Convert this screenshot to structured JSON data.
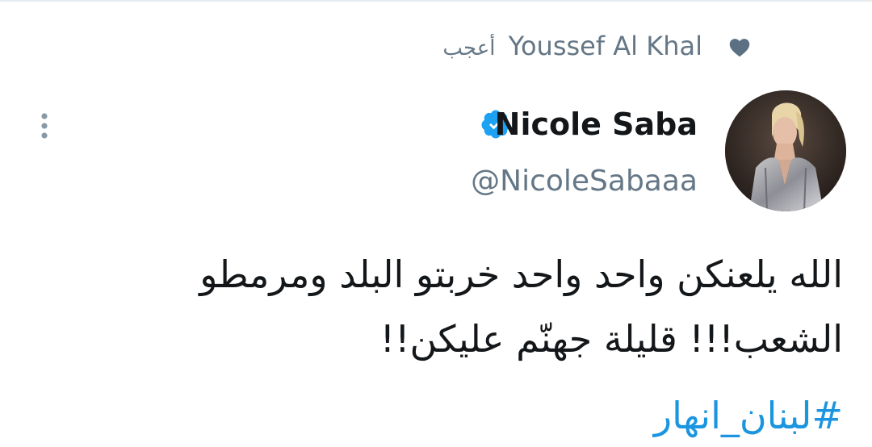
{
  "social_context": {
    "user": "Youssef Al Khal",
    "action": "أعجب",
    "icon": "heart-icon"
  },
  "tweet": {
    "display_name": "Nicole Saba",
    "verified": true,
    "handle": "@NicoleSabaaa",
    "text_lines": [
      "الله يلعنكن واحد واحد خربتو البلد ومرمطو",
      "الشعب!!! قليلة جهنّم عليكن!!"
    ],
    "hashtag": "#لبنان_انهار"
  },
  "colors": {
    "text_primary": "#14171a",
    "text_secondary": "#657786",
    "link": "#1b95e0",
    "verified": "#1da1f2"
  }
}
